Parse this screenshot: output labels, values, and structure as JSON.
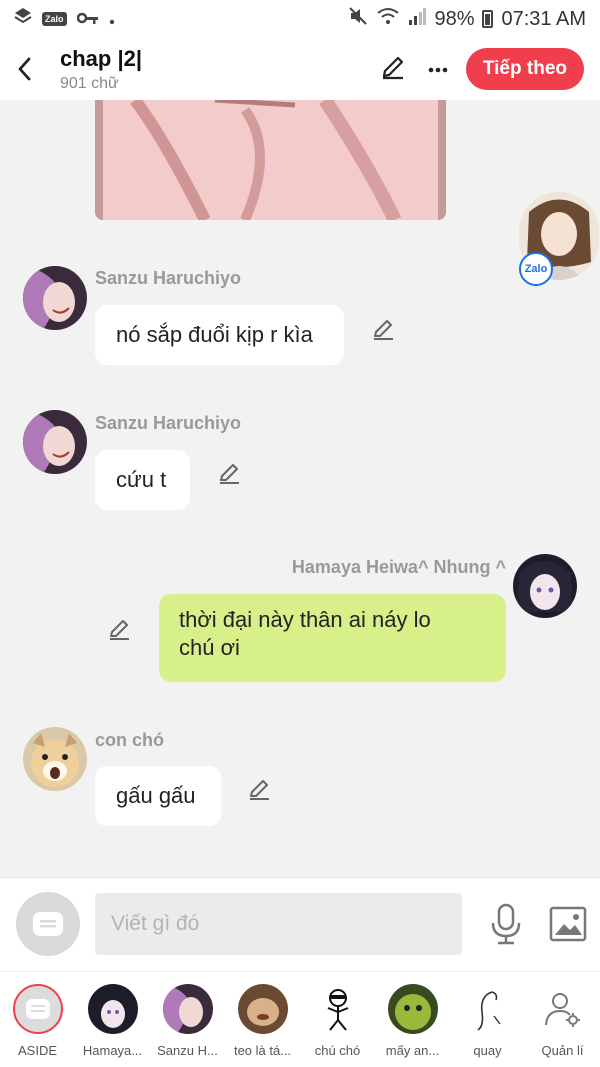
{
  "status_bar": {
    "battery_percent": "98%",
    "time": "07:31 AM",
    "zalo_label": "Zalo"
  },
  "header": {
    "title": "chap |2|",
    "subtitle": "901 chữ",
    "next_label": "Tiếp theo"
  },
  "float_badge": "Zalo",
  "messages": [
    {
      "sender": "Sanzu Haruchiyo",
      "text": "nó sắp đuổi kịp r kìa"
    },
    {
      "sender": "Sanzu Haruchiyo",
      "text": "cứu t"
    },
    {
      "sender": "Hamaya Heiwa^ Nhung ^",
      "text_line1": "thời đại này thân ai náy lo",
      "text_line2": "chú ơi"
    },
    {
      "sender": "con chó",
      "text": "gấu gấu"
    }
  ],
  "composer": {
    "placeholder": "Viết gì đó"
  },
  "tabs": [
    {
      "label": "ASIDE"
    },
    {
      "label": "Hamaya..."
    },
    {
      "label": "Sanzu H..."
    },
    {
      "label": "teo là tá..."
    },
    {
      "label": "chú chó"
    },
    {
      "label": "mấy an..."
    },
    {
      "label": "quay"
    },
    {
      "label": "Quản lí"
    }
  ],
  "colors": {
    "accent": "#f03e4d",
    "green_bubble": "#d7f08a",
    "background": "#f2f2f2"
  }
}
